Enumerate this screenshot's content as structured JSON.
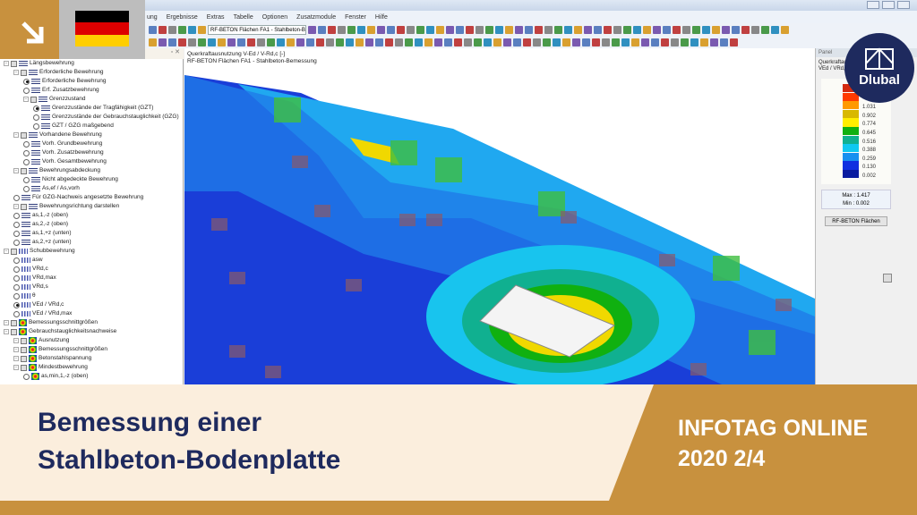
{
  "app": {
    "menu": [
      "ung",
      "Ergebnisse",
      "Extras",
      "Tabelle",
      "Optionen",
      "Zusatzmodule",
      "Fenster",
      "Hilfe"
    ],
    "combo": "RF-BETON Flächen FA1 - Stahlbeton-Be"
  },
  "tree": {
    "pin": "▫ ✕",
    "items": [
      {
        "label": "Längsbewehrung",
        "lvl": 0,
        "k": "cb",
        "i": "lines"
      },
      {
        "label": "Erforderliche Bewehrung",
        "lvl": 1,
        "k": "cb",
        "i": "lines"
      },
      {
        "label": "Erforderliche Bewehrung",
        "lvl": 2,
        "k": "on",
        "i": "lines"
      },
      {
        "label": "Erf. Zusatzbewehrung",
        "lvl": 2,
        "k": "rb",
        "i": "lines"
      },
      {
        "label": "Grenzzustand",
        "lvl": 2,
        "k": "cb",
        "i": "lines"
      },
      {
        "label": "Grenzzustände der Tragfähigkeit (GZT)",
        "lvl": 3,
        "k": "on",
        "i": "lines"
      },
      {
        "label": "Grenzzustände der Gebrauchstauglichkeit (GZG)",
        "lvl": 3,
        "k": "rb",
        "i": "lines"
      },
      {
        "label": "GZT / GZG maßgebend",
        "lvl": 3,
        "k": "rb",
        "i": "lines"
      },
      {
        "label": "Vorhandene Bewehrung",
        "lvl": 1,
        "k": "cb",
        "i": "lines"
      },
      {
        "label": "Vorh. Grundbewehrung",
        "lvl": 2,
        "k": "rb",
        "i": "lines"
      },
      {
        "label": "Vorh. Zusatzbewehrung",
        "lvl": 2,
        "k": "rb",
        "i": "lines"
      },
      {
        "label": "Vorh. Gesamtbewehrung",
        "lvl": 2,
        "k": "rb",
        "i": "lines"
      },
      {
        "label": "Bewehrungsabdeckung",
        "lvl": 1,
        "k": "cb",
        "i": "lines"
      },
      {
        "label": "Nicht abgedeckte Bewehrung",
        "lvl": 2,
        "k": "rb",
        "i": "lines"
      },
      {
        "label": "As,ef / As,vorh",
        "lvl": 2,
        "k": "rb",
        "i": "lines"
      },
      {
        "label": "Für GZG-Nachweis angesetzte Bewehrung",
        "lvl": 1,
        "k": "rb",
        "i": "lines"
      },
      {
        "label": "Bewehrungsrichtung darstellen",
        "lvl": 1,
        "k": "cb",
        "i": "lines"
      },
      {
        "label": "as,1,-z (oben)",
        "lvl": 1,
        "k": "rb",
        "i": "lines"
      },
      {
        "label": "as,2,-z (oben)",
        "lvl": 1,
        "k": "rb",
        "i": "lines"
      },
      {
        "label": "as,1,+z (unten)",
        "lvl": 1,
        "k": "rb",
        "i": "lines"
      },
      {
        "label": "as,2,+z (unten)",
        "lvl": 1,
        "k": "rb",
        "i": "lines"
      },
      {
        "label": "Schubbewehrung",
        "lvl": 0,
        "k": "cb",
        "i": "bars"
      },
      {
        "label": "asw",
        "lvl": 1,
        "k": "rb",
        "i": "bars"
      },
      {
        "label": "VRd,c",
        "lvl": 1,
        "k": "rb",
        "i": "bars"
      },
      {
        "label": "VRd,max",
        "lvl": 1,
        "k": "rb",
        "i": "bars"
      },
      {
        "label": "VRd,s",
        "lvl": 1,
        "k": "rb",
        "i": "bars"
      },
      {
        "label": "θ",
        "lvl": 1,
        "k": "rb",
        "i": "bars"
      },
      {
        "label": "VEd / VRd,c",
        "lvl": 1,
        "k": "on",
        "i": "bars"
      },
      {
        "label": "VEd / VRd,max",
        "lvl": 1,
        "k": "rb",
        "i": "bars"
      },
      {
        "label": "Bemessungsschnittgrößen",
        "lvl": 0,
        "k": "cb",
        "i": "heat"
      },
      {
        "label": "Gebrauchstauglichkeitsnachweise",
        "lvl": 0,
        "k": "cb",
        "i": "heat"
      },
      {
        "label": "Ausnutzung",
        "lvl": 1,
        "k": "cb",
        "i": "heat"
      },
      {
        "label": "Bemessungsschnittgrößen",
        "lvl": 1,
        "k": "cb",
        "i": "heat"
      },
      {
        "label": "Betonstahlspannung",
        "lvl": 1,
        "k": "cb",
        "i": "heat"
      },
      {
        "label": "Mindestbewehrung",
        "lvl": 1,
        "k": "cb",
        "i": "heat"
      },
      {
        "label": "as,min,1,-z (oben)",
        "lvl": 2,
        "k": "rb",
        "i": "heat"
      }
    ]
  },
  "view": {
    "line1": "Querkraftausnutzung V-Ed / V-Rd,c [-]",
    "line2": "RF-BETON Flächen FA1 - Stahlbeton-Bemessung"
  },
  "panel": {
    "header": "Panel",
    "title1": "Querkraftau",
    "title2": "VEd / VRd,c",
    "legend": [
      {
        "c": "#d42a10"
      },
      {
        "c": "#ff3a00"
      },
      {
        "c": "#ff9900",
        "v": "1.031"
      },
      {
        "c": "#d8b800",
        "v": "0.902"
      },
      {
        "c": "#ffee00",
        "v": "0.774"
      },
      {
        "c": "#10b010",
        "v": "0.645"
      },
      {
        "c": "#10b090",
        "v": "0.516"
      },
      {
        "c": "#10c8f0",
        "v": "0.388"
      },
      {
        "c": "#1890f0",
        "v": "0.259"
      },
      {
        "c": "#1030e0",
        "v": "0.130"
      },
      {
        "c": "#0a1ca0",
        "v": "0.002"
      }
    ],
    "max_label": "Max",
    "max": "1.417",
    "min_label": "Min",
    "min": "0.002",
    "button": "RF-BETON Flächen"
  },
  "brand": {
    "name": "Dlubal"
  },
  "banner": {
    "title1": "Bemessung einer",
    "title2": "Stahlbeton-Bodenplatte",
    "tag1": "INFOTAG ONLINE",
    "tag2": "2020 2/4"
  },
  "colors": {
    "gold": "#c8913e",
    "navy": "#1e2a5e",
    "cream": "#fbeedd"
  }
}
